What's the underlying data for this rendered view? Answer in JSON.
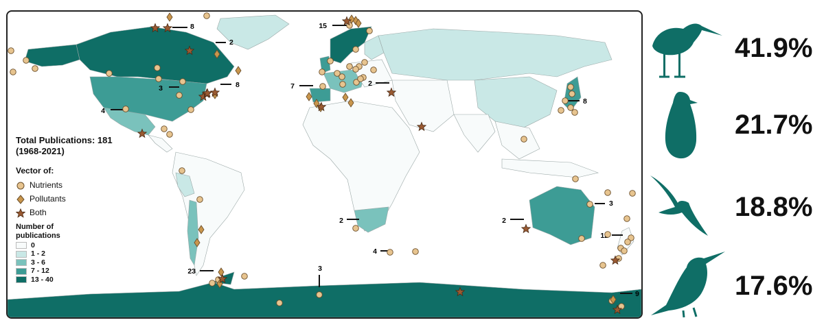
{
  "colors": {
    "scale_0": "#f8fbfb",
    "scale_1_2": "#c9e8e6",
    "scale_3_6": "#7ac2bc",
    "scale_7_12": "#3d9c95",
    "scale_13_40": "#0f6e66",
    "marker_fill": "#e7c48f",
    "marker_stroke": "#6b4e2a",
    "pollutant_fill": "#c9964d",
    "both_fill": "#9a5a32",
    "bird": "#0f6e66"
  },
  "legend": {
    "total_title": "Total Publications: 181",
    "total_years": "(1968-2021)",
    "vector_title": "Vector of:",
    "vectors": [
      {
        "label": "Nutrients",
        "shape": "circle"
      },
      {
        "label": "Pollutants",
        "shape": "diamond"
      },
      {
        "label": "Both",
        "shape": "star"
      }
    ],
    "scale_title_1": "Number of",
    "scale_title_2": "publications",
    "scale": [
      {
        "label": "0",
        "color_key": "scale_0"
      },
      {
        "label": "1 - 2",
        "color_key": "scale_1_2"
      },
      {
        "label": "3 - 6",
        "color_key": "scale_3_6"
      },
      {
        "label": "7 - 12",
        "color_key": "scale_7_12"
      },
      {
        "label": "13 - 40",
        "color_key": "scale_13_40"
      }
    ]
  },
  "count_labels": [
    "15",
    "8",
    "2",
    "3",
    "8",
    "7",
    "2",
    "4",
    "8",
    "2",
    "2",
    "3",
    "4",
    "12",
    "23",
    "3",
    "9"
  ],
  "birds": [
    {
      "icon": "shorebird-icon",
      "percent": "41.9%"
    },
    {
      "icon": "penguin-icon",
      "percent": "21.7%"
    },
    {
      "icon": "albatross-icon",
      "percent": "18.8%"
    },
    {
      "icon": "booby-icon",
      "percent": "17.6%"
    }
  ]
}
